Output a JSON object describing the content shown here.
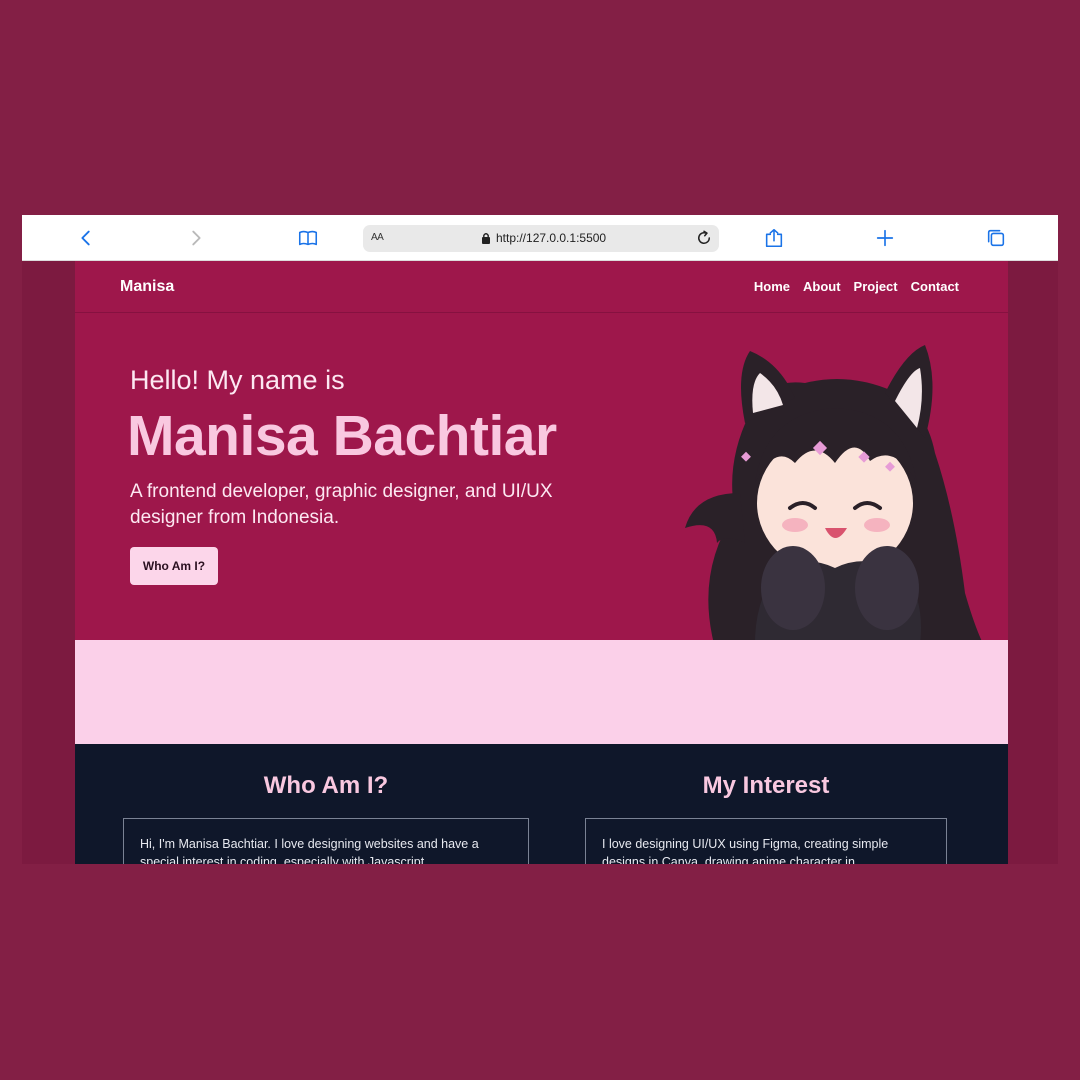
{
  "browser": {
    "font_size_label": "AA",
    "url": "http://127.0.0.1:5500"
  },
  "nav": {
    "brand": "Manisa",
    "links": [
      "Home",
      "About",
      "Project",
      "Contact"
    ]
  },
  "hero": {
    "greeting": "Hello! My name is",
    "name": "Manisa Bachtiar",
    "description": "A frontend developer, graphic designer, and UI/UX designer from Indonesia.",
    "cta_label": "Who Am I?"
  },
  "sections": {
    "who": {
      "title": "Who Am I?",
      "text": "Hi, I'm Manisa Bachtiar. I love designing websites and have a special interest in coding, especially with Javascript."
    },
    "interest": {
      "title": "My Interest",
      "text": "I love designing UI/UX using Figma, creating simple designs in Canva, drawing anime character in"
    }
  },
  "colors": {
    "outer_bg": "#831f45",
    "hero_bg": "#9e174b",
    "accent_pink": "#f9c8e0",
    "light_pink_band": "#fbd0e9",
    "dark_section": "#0f172a",
    "browser_icon_blue": "#1a73e8"
  }
}
